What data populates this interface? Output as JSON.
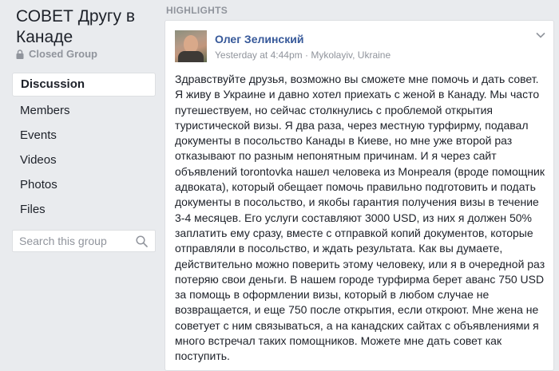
{
  "group": {
    "title": "СОВЕТ Другу в Канаде",
    "privacy": "Closed Group"
  },
  "nav": {
    "items": [
      {
        "label": "Discussion",
        "active": true
      },
      {
        "label": "Members"
      },
      {
        "label": "Events"
      },
      {
        "label": "Videos"
      },
      {
        "label": "Photos"
      },
      {
        "label": "Files"
      }
    ]
  },
  "search": {
    "placeholder": "Search this group",
    "value": ""
  },
  "highlights": {
    "heading": "HIGHLIGHTS"
  },
  "post": {
    "author": "Олег Зелинский",
    "time": "Yesterday at 4:44pm",
    "separator": "·",
    "location": "Mykolayiv, Ukraine",
    "body": "Здравствуйте друзья, возможно вы сможете мне помочь и дать совет. Я живу в Украине и давно хотел приехать с женой в Канаду. Мы часто путешествуем, но сейчас столкнулись с проблемой открытия туристической визы. Я два раза, через местную турфирму, подавал документы в посольство Канады в Киеве, но мне уже второй раз отказывают по разным непонятным причинам. И я через сайт объявлений torontovka нашел человека из Монреаля (вроде помощник адвоката), который обещает помочь правильно подготовить и подать документы в посольство, и якобы гарантия получения визы в течение 3-4 месяцев. Его услуги составляют 3000 USD, из них я должен 50% заплатить ему сразу, вместе с отправкой копий документов, которые отправляли в посольство, и ждать результата. Как вы думаете, действительно можно поверить этому человеку, или я в очередной раз потеряю свои деньги. В нашем городе турфирма берет аванс 750 USD за помощь в оформлении визы, который в любом случае не возвращается, и еще 750 после открытия, если откроют. Мне жена не советует с ним связываться, а на канадских сайтах с объявлениями я много встречал таких помощников. Можете мне дать совет как поступить."
  },
  "colors": {
    "page_background": "#e9ebee",
    "link_blue": "#365899",
    "muted_text": "#90949c",
    "card_border": "#dddfe2"
  }
}
